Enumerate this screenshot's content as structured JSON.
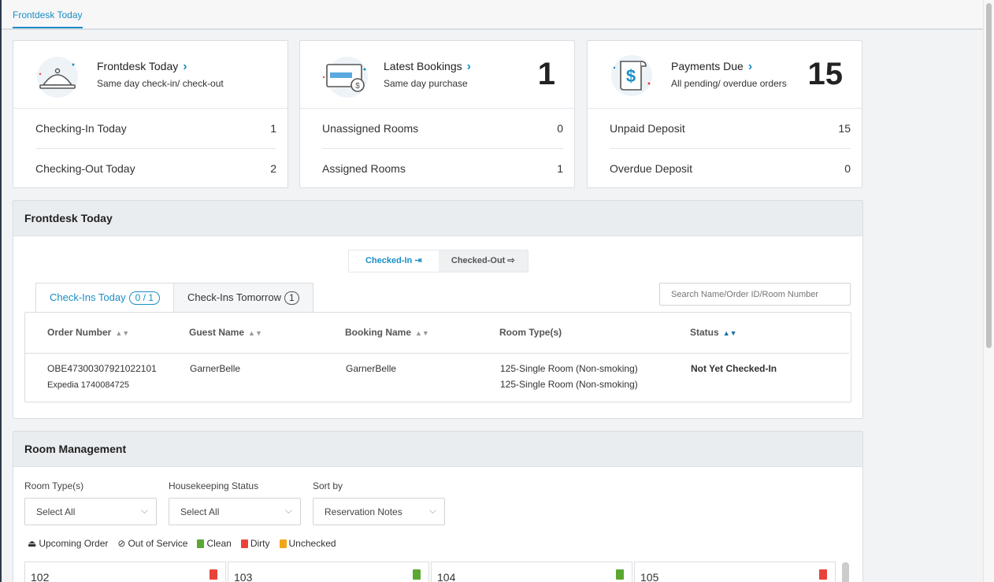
{
  "top_tab": "Frontdesk Today",
  "cards": [
    {
      "title": "Frontdesk Today",
      "chevron": "›",
      "subtitle": "Same day check-in/ check-out",
      "icon": "bell-icon",
      "count": "",
      "rows": [
        {
          "label": "Checking-In Today",
          "value": "1"
        },
        {
          "label": "Checking-Out Today",
          "value": "2"
        }
      ]
    },
    {
      "title": "Latest Bookings",
      "chevron": "›",
      "subtitle": "Same day purchase",
      "icon": "credit-card-icon",
      "count": "1",
      "rows": [
        {
          "label": "Unassigned Rooms",
          "value": "0"
        },
        {
          "label": "Assigned Rooms",
          "value": "1"
        }
      ]
    },
    {
      "title": "Payments Due",
      "chevron": "›",
      "subtitle": "All pending/ overdue orders",
      "icon": "invoice-dollar-icon",
      "count": "15",
      "rows": [
        {
          "label": "Unpaid Deposit",
          "value": "15"
        },
        {
          "label": "Overdue Deposit",
          "value": "0"
        }
      ]
    }
  ],
  "frontdesk_panel": {
    "title": "Frontdesk Today",
    "toggle": {
      "checked_in": "Checked-In",
      "checked_out": "Checked-Out",
      "active": "checked_in"
    },
    "tabs": [
      {
        "label": "Check-Ins Today",
        "badge": "0 / 1"
      },
      {
        "label": "Check-Ins Tomorrow",
        "badge": "1"
      }
    ],
    "search_placeholder": "Search Name/Order ID/Room Number",
    "columns": [
      "Order Number",
      "Guest Name",
      "Booking Name",
      "Room Type(s)",
      "Status"
    ],
    "rows": [
      {
        "order": "OBE47300307921022101",
        "source": "Expedia 1740084725",
        "guest": "GarnerBelle",
        "booking": "GarnerBelle",
        "room_types": [
          "125-Single Room (Non-smoking)",
          "125-Single Room (Non-smoking)"
        ],
        "status": "Not Yet Checked-In"
      }
    ]
  },
  "room_panel": {
    "title": "Room Management",
    "filters": [
      {
        "label": "Room Type(s)",
        "value": "Select All"
      },
      {
        "label": "Housekeeping Status",
        "value": "Select All"
      },
      {
        "label": "Sort by",
        "value": "Reservation Notes"
      }
    ],
    "legend": [
      {
        "label": "Upcoming Order",
        "icon": "bell-icon"
      },
      {
        "label": "Out of Service",
        "icon": "ban-icon"
      },
      {
        "label": "Clean",
        "icon": "clipboard-icon",
        "color": "#5aa832"
      },
      {
        "label": "Dirty",
        "icon": "clipboard-icon",
        "color": "#e8433b"
      },
      {
        "label": "Unchecked",
        "icon": "clipboard-icon",
        "color": "#f2a71b"
      }
    ],
    "rooms": [
      {
        "number": "102",
        "status_color": "#e8433b"
      },
      {
        "number": "103",
        "status_color": "#5aa832"
      },
      {
        "number": "104",
        "status_color": "#5aa832"
      },
      {
        "number": "105",
        "status_color": "#e8433b"
      }
    ]
  }
}
